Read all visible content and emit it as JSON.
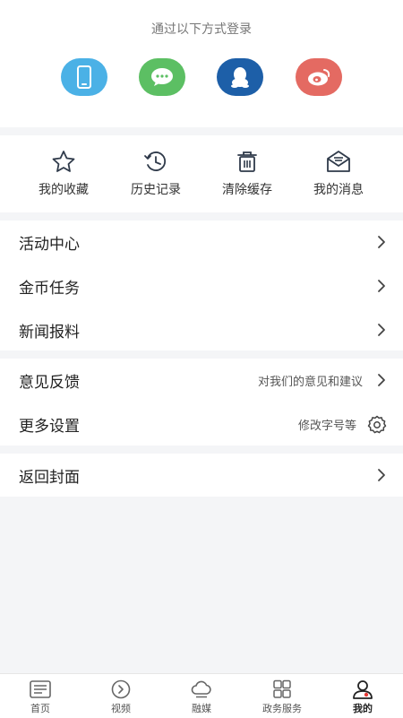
{
  "login": {
    "title": "通过以下方式登录",
    "buttons": [
      {
        "name": "phone",
        "color": "#4bb1e6"
      },
      {
        "name": "wechat",
        "color": "#5cbf63"
      },
      {
        "name": "qq",
        "color": "#1d5fa8"
      },
      {
        "name": "weibo",
        "color": "#e46a62"
      }
    ]
  },
  "quick_actions": [
    {
      "label": "我的收藏",
      "icon": "star-icon"
    },
    {
      "label": "历史记录",
      "icon": "history-icon"
    },
    {
      "label": "清除缓存",
      "icon": "trash-icon"
    },
    {
      "label": "我的消息",
      "icon": "message-icon"
    }
  ],
  "menu": {
    "activity": "活动中心",
    "coin_tasks": "金币任务",
    "news_report": "新闻报料",
    "feedback": "意见反馈",
    "feedback_hint": "对我们的意见和建议",
    "more_settings": "更多设置",
    "settings_hint": "修改字号等",
    "return_cover": "返回封面"
  },
  "tabs": [
    {
      "label": "首页",
      "icon": "news-icon"
    },
    {
      "label": "视频",
      "icon": "video-icon"
    },
    {
      "label": "融媒",
      "icon": "cloud-icon"
    },
    {
      "label": "政务服务",
      "icon": "grid-icon"
    },
    {
      "label": "我的",
      "icon": "user-icon",
      "active": true
    }
  ]
}
